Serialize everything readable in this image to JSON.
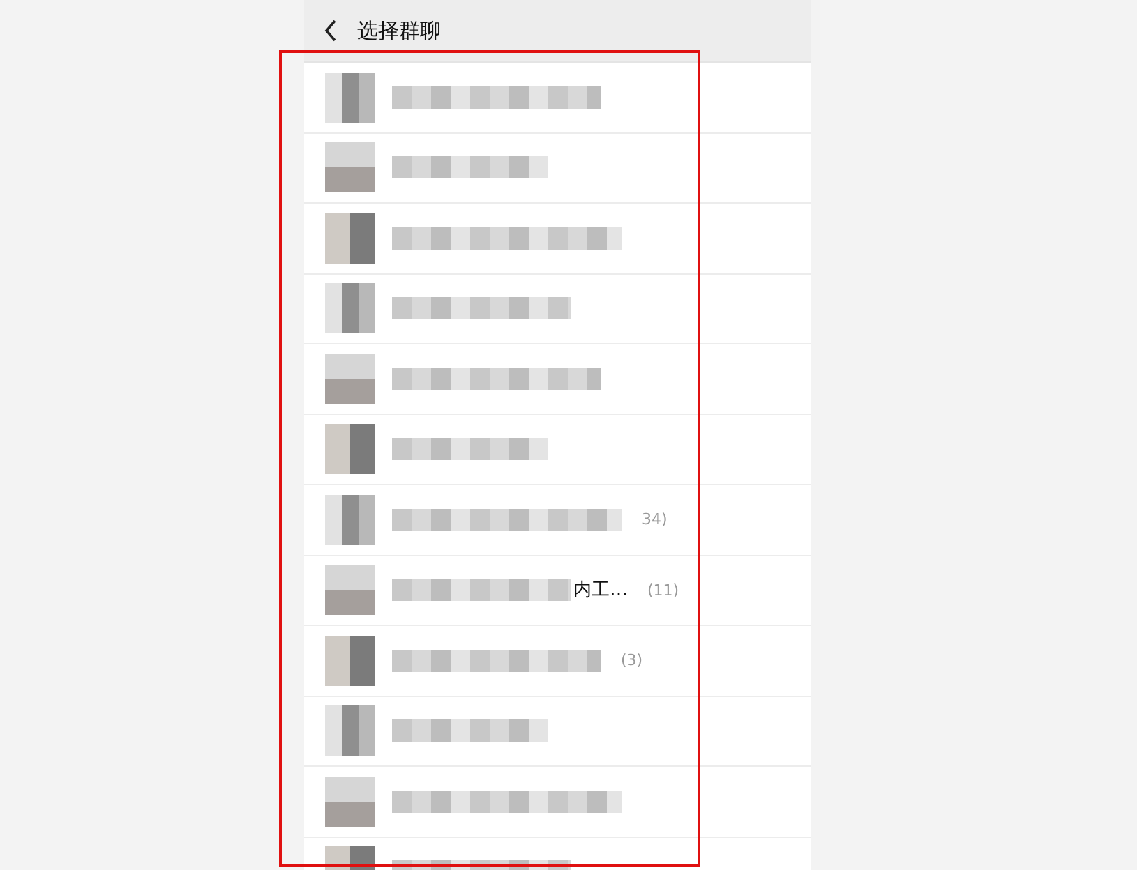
{
  "header": {
    "title": "选择群聊"
  },
  "rows": [
    {
      "blurred": true
    },
    {
      "blurred": true
    },
    {
      "blurred": true
    },
    {
      "blurred": true
    },
    {
      "blurred": true
    },
    {
      "blurred": true
    },
    {
      "blurred": true,
      "count": "34)"
    },
    {
      "blurred": true,
      "name_tail": "内工…",
      "count": "(11)"
    },
    {
      "blurred": true,
      "count": "(3)"
    },
    {
      "blurred": true
    },
    {
      "blurred": true
    },
    {
      "blurred": true
    }
  ],
  "highlight_frame": true
}
